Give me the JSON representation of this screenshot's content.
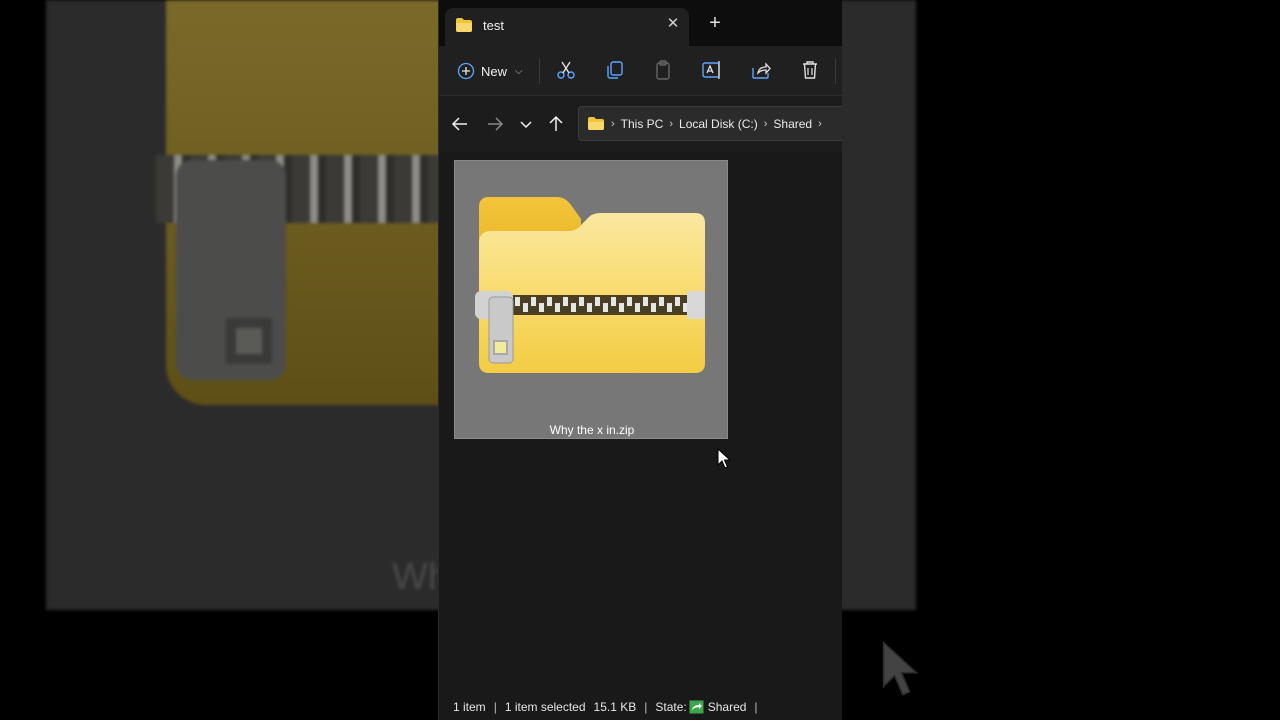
{
  "tab": {
    "title": "test",
    "close_glyph": "✕",
    "new_tab_glyph": "+"
  },
  "toolbar": {
    "new_label": "New",
    "new_chevron": "⌵",
    "icons": [
      "plus-circle-icon",
      "cut-icon",
      "copy-icon",
      "paste-icon",
      "rename-icon",
      "share-icon",
      "delete-icon"
    ]
  },
  "navigation": {
    "icons": [
      "back-arrow-icon",
      "forward-arrow-icon",
      "recent-chevron-icon",
      "up-arrow-icon"
    ],
    "breadcrumb": [
      "This PC",
      "Local Disk (C:)",
      "Shared"
    ],
    "crumb_separator": "›"
  },
  "file": {
    "name": "Why the x in.zip"
  },
  "background": {
    "ghost_text": "Why t"
  },
  "status": {
    "item_count": "1 item",
    "selection": "1 item selected",
    "size": "15.1 KB",
    "state_label": "State:",
    "state_value": "Shared",
    "separator": "|"
  },
  "colors": {
    "folder_yellow": "#f5d257",
    "folder_tab": "#f0c53a",
    "window_bg": "#191919",
    "selection_tile": "#777777",
    "shared_green": "#3da64a",
    "accent_blue": "#5aa6ff"
  }
}
